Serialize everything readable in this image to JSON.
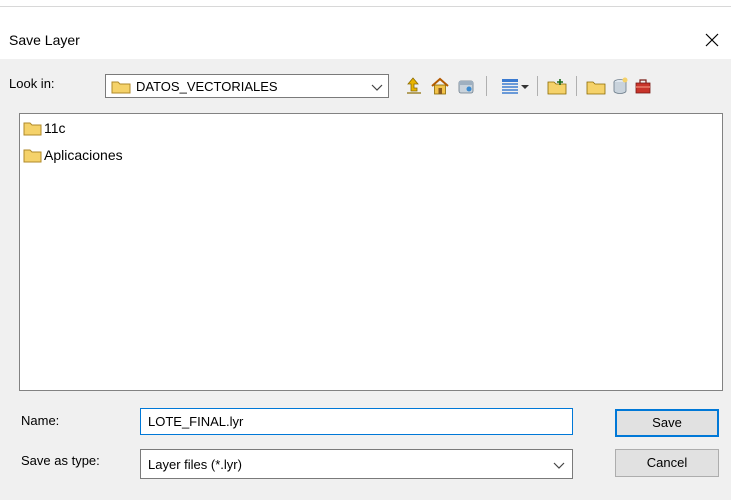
{
  "window": {
    "title": "Save Layer"
  },
  "lookin": {
    "label": "Look in:",
    "folder": "DATOS_VECTORIALES"
  },
  "toolbar": {
    "icons": [
      "up-one-level-icon",
      "home-icon",
      "catalog-icon",
      "view-menu-icon",
      "new-folder-icon",
      "folder-icon",
      "database-icon",
      "toolbox-icon"
    ]
  },
  "files": [
    {
      "name": "11c",
      "icon": "folder-icon"
    },
    {
      "name": "Aplicaciones",
      "icon": "folder-icon"
    }
  ],
  "form": {
    "name_label": "Name:",
    "name_value": "LOTE_FINAL.lyr",
    "type_label": "Save as type:",
    "type_value": "Layer files (*.lyr)"
  },
  "buttons": {
    "save": "Save",
    "cancel": "Cancel"
  },
  "colors": {
    "accent": "#0078d7",
    "folder": "#f5d26a"
  }
}
